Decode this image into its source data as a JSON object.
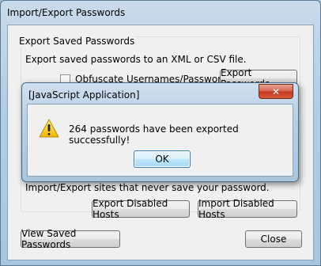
{
  "window": {
    "title": "Import/Export Passwords"
  },
  "export_group": {
    "legend": "Export Saved Passwords",
    "description": "Export saved passwords to an XML or CSV file.",
    "obfuscate_label": "Obfuscate Usernames/Passwords",
    "obfuscate_checked": false,
    "export_button": "Export Passwords"
  },
  "disabled_hosts": {
    "note": "Import/Export sites that never save your password.",
    "export_button": "Export Disabled Hosts",
    "import_button": "Import Disabled Hosts"
  },
  "footer": {
    "view_button": "View Saved Passwords",
    "close_button": "Close"
  },
  "alert": {
    "title": "[JavaScript Application]",
    "close_glyph": "✕",
    "message": "264 passwords have been exported successfully!",
    "ok_button": "OK"
  },
  "icons": {
    "alert_icon": "warning-icon",
    "close_icon": "close-icon"
  }
}
